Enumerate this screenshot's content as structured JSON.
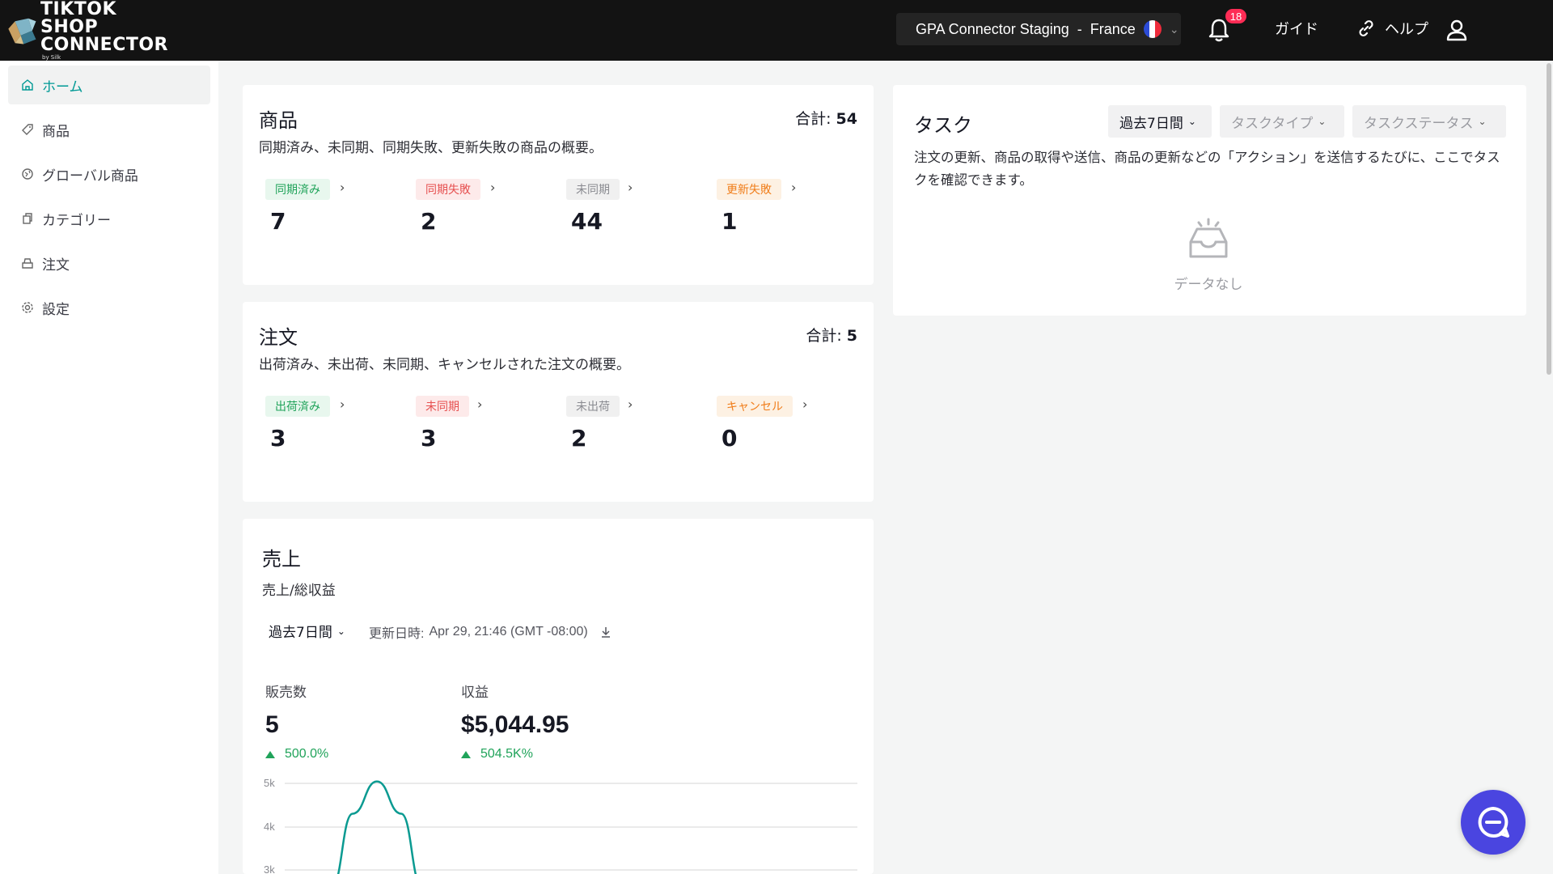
{
  "brand": {
    "line1": "TIKTOK SHOP",
    "line2": "CONNECTOR",
    "by": "by Silk"
  },
  "topbar": {
    "store_name": "GPA Connector Staging",
    "store_sep": "-",
    "store_country": "France",
    "notification_count": "18",
    "guide_label": "ガイド",
    "help_label": "ヘルプ"
  },
  "sidebar": {
    "items": [
      {
        "label": "ホーム",
        "icon": "home-icon",
        "active": true
      },
      {
        "label": "商品",
        "icon": "tag-icon"
      },
      {
        "label": "グローバル商品",
        "icon": "globe-icon"
      },
      {
        "label": "カテゴリー",
        "icon": "copy-icon"
      },
      {
        "label": "注文",
        "icon": "order-icon"
      },
      {
        "label": "設定",
        "icon": "settings-icon"
      }
    ]
  },
  "products": {
    "title": "商品",
    "total_label": "合計:",
    "total": "54",
    "desc": "同期済み、未同期、同期失敗、更新失敗の商品の概要。",
    "stats": [
      {
        "label": "同期済み",
        "value": "7",
        "color": "#20a35a"
      },
      {
        "label": "同期失敗",
        "value": "2",
        "color": "#e65050"
      },
      {
        "label": "未同期",
        "value": "44",
        "color": "#8a8b91"
      },
      {
        "label": "更新失敗",
        "value": "1",
        "color": "#f07d1a"
      }
    ]
  },
  "orders": {
    "title": "注文",
    "total_label": "合計:",
    "total": "5",
    "desc": "出荷済み、未出荷、未同期、キャンセルされた注文の概要。",
    "stats": [
      {
        "label": "出荷済み",
        "value": "3",
        "color": "#20a35a"
      },
      {
        "label": "未同期",
        "value": "3",
        "color": "#e65050"
      },
      {
        "label": "未出荷",
        "value": "2",
        "color": "#8a8b91"
      },
      {
        "label": "キャンセル",
        "value": "0",
        "color": "#f07d1a"
      }
    ]
  },
  "sales": {
    "title": "売上",
    "subtitle": "売上/総収益",
    "period": "過去7日間",
    "updated_label": "更新日時:",
    "updated_value": "Apr 29, 21:46 (GMT -08:00)",
    "metrics": [
      {
        "label": "販売数",
        "value": "5",
        "change": "500.0%"
      },
      {
        "label": "収益",
        "value": "$5,044.95",
        "change": "504.5K%"
      }
    ]
  },
  "tasks": {
    "title": "タスク",
    "filters": [
      "過去7日間",
      "タスクタイプ",
      "タスクステータス"
    ],
    "desc": "注文の更新、商品の取得や送信、商品の更新などの「アクション」を送信するたびに、ここでタスクを確認できます。",
    "empty": "データなし"
  },
  "chart_data": {
    "type": "line",
    "title": "",
    "xlabel": "",
    "ylabel": "",
    "y_ticks": [
      "5k",
      "4k",
      "3k"
    ],
    "ylim_visible": [
      3000,
      5000
    ],
    "series": [
      {
        "values_visible": [
          2600,
          4300,
          5044.95,
          4300,
          2600
        ]
      }
    ],
    "color": "#0a9a91",
    "grid": true
  }
}
